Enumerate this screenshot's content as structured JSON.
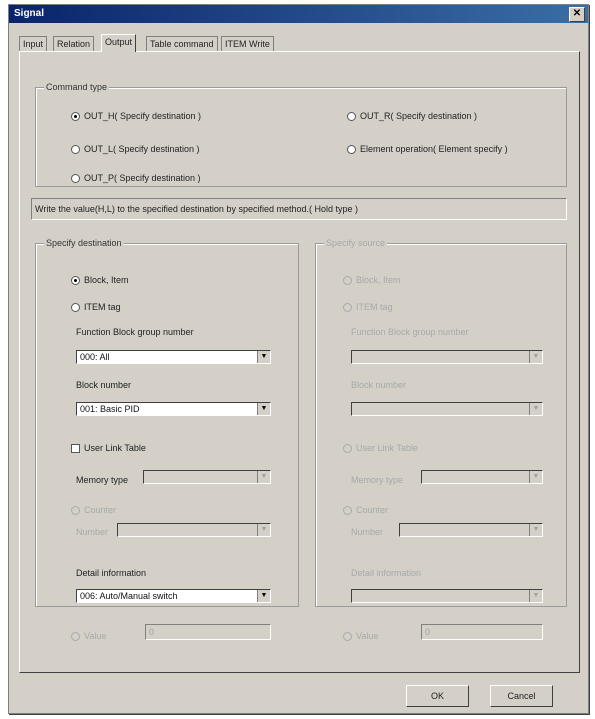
{
  "window": {
    "title": "Signal"
  },
  "tabs": [
    "Input",
    "Relation",
    "Output",
    "Table command",
    "ITEM Write"
  ],
  "command_type": {
    "label": "Command type",
    "options": [
      "OUT_H( Specify destination )",
      "OUT_L( Specify destination )",
      "OUT_P( Specify destination )",
      "OUT_R( Specify destination )",
      "Element operation( Element specify )"
    ],
    "selected": "OUT_H( Specify destination )"
  },
  "description": "Write the value(H,L) to the specified destination by specified method.( Hold type )",
  "specify_destination": {
    "label": "Specify destination",
    "block_item": "Block, Item",
    "item_tag": "ITEM tag",
    "fb_group_label": "Function Block group number",
    "fb_group_value": "000: All",
    "block_number_label": "Block number",
    "block_number_value": "001: Basic PID",
    "user_link_table": "User Link Table",
    "memory_type_label": "Memory type",
    "counter": "Counter",
    "number_label": "Number",
    "detail_label": "Detail information",
    "detail_value": "006: Auto/Manual switch",
    "value": "Value",
    "value_input": "0"
  },
  "source_disabled": {
    "label": "Specify source",
    "block_item": "Block, Item",
    "item_tag": "ITEM tag",
    "fb_group_label": "Function Block group number",
    "block_number_label": "Block number",
    "user_link_table": "User Link Table",
    "memory_type_label": "Memory type",
    "counter": "Counter",
    "number_label": "Number",
    "detail_label": "Detail information",
    "value": "Value",
    "value_input": "0"
  },
  "buttons": {
    "ok": "OK",
    "cancel": "Cancel"
  }
}
